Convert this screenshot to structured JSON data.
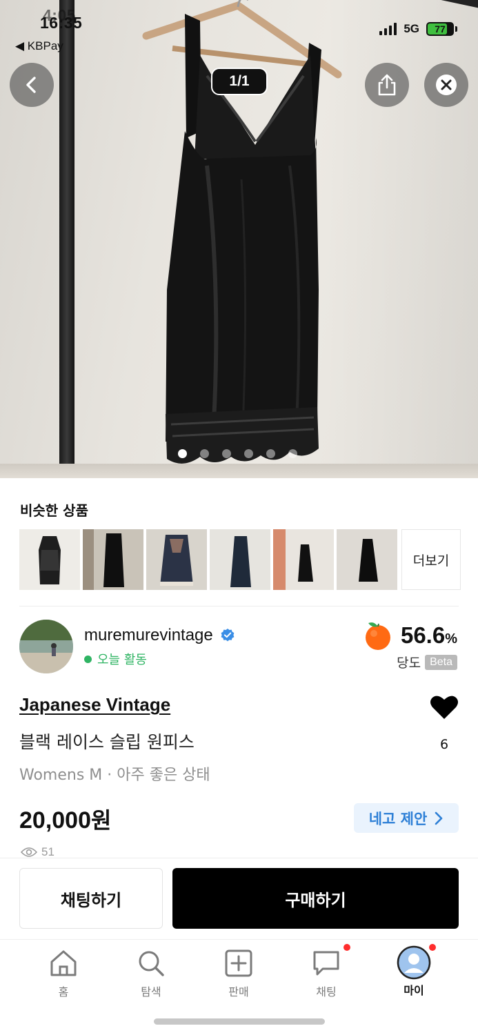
{
  "status_bar": {
    "time": "16:35",
    "time_overlay": "4:05",
    "back_app": "◀ KBPay",
    "network": "5G",
    "battery": "77"
  },
  "viewer": {
    "counter": "1/1",
    "dots": {
      "total": 6,
      "active_index": 0
    }
  },
  "similar": {
    "title": "비슷한 상품",
    "more_label": "더보기",
    "thumbs": [
      {
        "name": "similar-thumb-1"
      },
      {
        "name": "similar-thumb-2"
      },
      {
        "name": "similar-thumb-3"
      },
      {
        "name": "similar-thumb-4"
      },
      {
        "name": "similar-thumb-5"
      },
      {
        "name": "similar-thumb-6"
      }
    ]
  },
  "seller": {
    "name": "muremurevintage",
    "activity": "오늘 활동",
    "score_value": "56.6",
    "score_unit": "%",
    "score_label": "당도",
    "score_badge": "Beta"
  },
  "product": {
    "brand": "Japanese Vintage",
    "title": "블랙 레이스 슬립 원피스",
    "meta": "Womens M · 아주 좋은 상태",
    "likes": "6",
    "price": "20,000",
    "currency": "원",
    "negotiate_label": "네고 제안",
    "views": "51"
  },
  "actions": {
    "chat_label": "채팅하기",
    "buy_label": "구매하기"
  },
  "tabbar": {
    "home": "홈",
    "search": "탐색",
    "sell": "판매",
    "chat": "채팅",
    "my": "마이"
  },
  "colors": {
    "accent_blue": "#2d7fd6",
    "active_green": "#2fb463",
    "badge_red": "#ff2d2d",
    "buy_button": "#000000"
  }
}
